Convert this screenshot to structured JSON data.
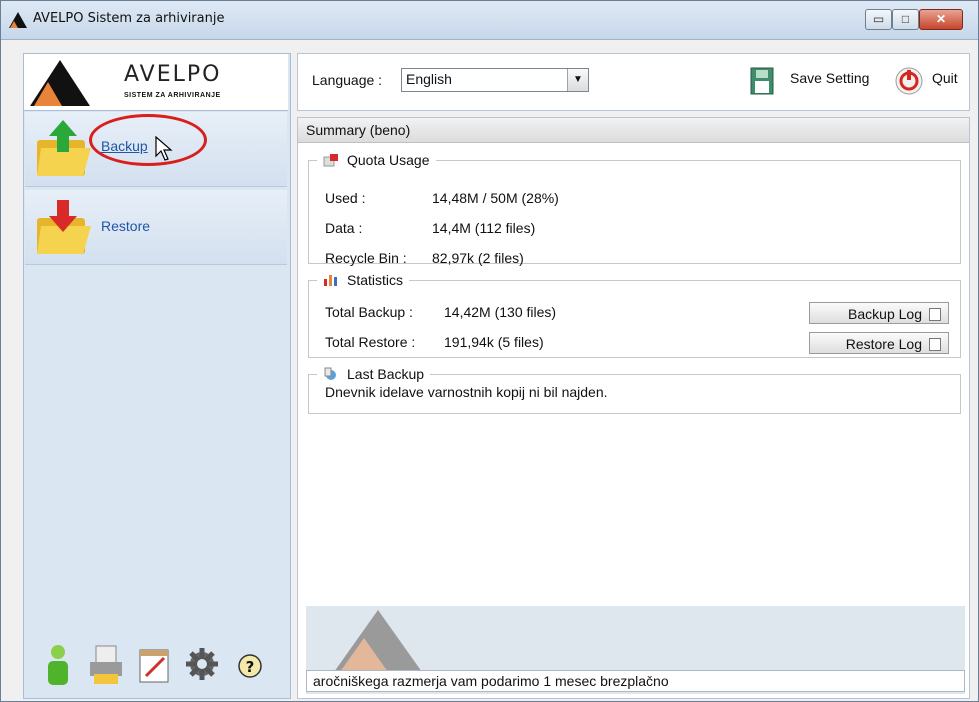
{
  "window": {
    "title": "AVELPO Sistem za arhiviranje",
    "controls": {
      "minimize": "▭",
      "maximize": "□",
      "close": "✕"
    }
  },
  "sidebar": {
    "logo": {
      "brand": "AVELPO",
      "subtitle": "SISTEM ZA ARHIVIRANJE"
    },
    "items": [
      {
        "label": "Backup",
        "icon": "folder-upload-icon",
        "highlighted": true
      },
      {
        "label": "Restore",
        "icon": "folder-download-icon",
        "highlighted": false
      }
    ],
    "tools": [
      "user-icon",
      "printer-icon",
      "calendar-icon",
      "gear-icon",
      "help-icon"
    ]
  },
  "toolbar": {
    "language_label": "Language :",
    "language_value": "English",
    "save_label": "Save Setting",
    "quit_label": "Quit"
  },
  "summary": {
    "title": "Summary (beno)",
    "quota": {
      "heading": "Quota Usage",
      "used_label": "Used :",
      "used_value": "14,48M / 50M (28%)",
      "data_label": "Data :",
      "data_value": "14,4M  (112 files)",
      "recycle_label": "Recycle Bin :",
      "recycle_value": "82,97k  (2 files)"
    },
    "statistics": {
      "heading": "Statistics",
      "backup_label": "Total Backup :",
      "backup_value": "14,42M  (130 files)",
      "restore_label": "Total Restore :",
      "restore_value": "191,94k  (5 files)",
      "backup_log_button": "Backup Log",
      "restore_log_button": "Restore Log"
    },
    "last_backup": {
      "heading": "Last Backup",
      "message": "Dnevnik idelave varnostnih kopij ni bil najden."
    },
    "banner_text": "aročniškega razmerja vam podarimo 1 mesec brezplačno"
  },
  "colors": {
    "accent": "#1f56a6",
    "highlight": "#d91e1e",
    "sidebar_bg": "#dbe6f3"
  }
}
